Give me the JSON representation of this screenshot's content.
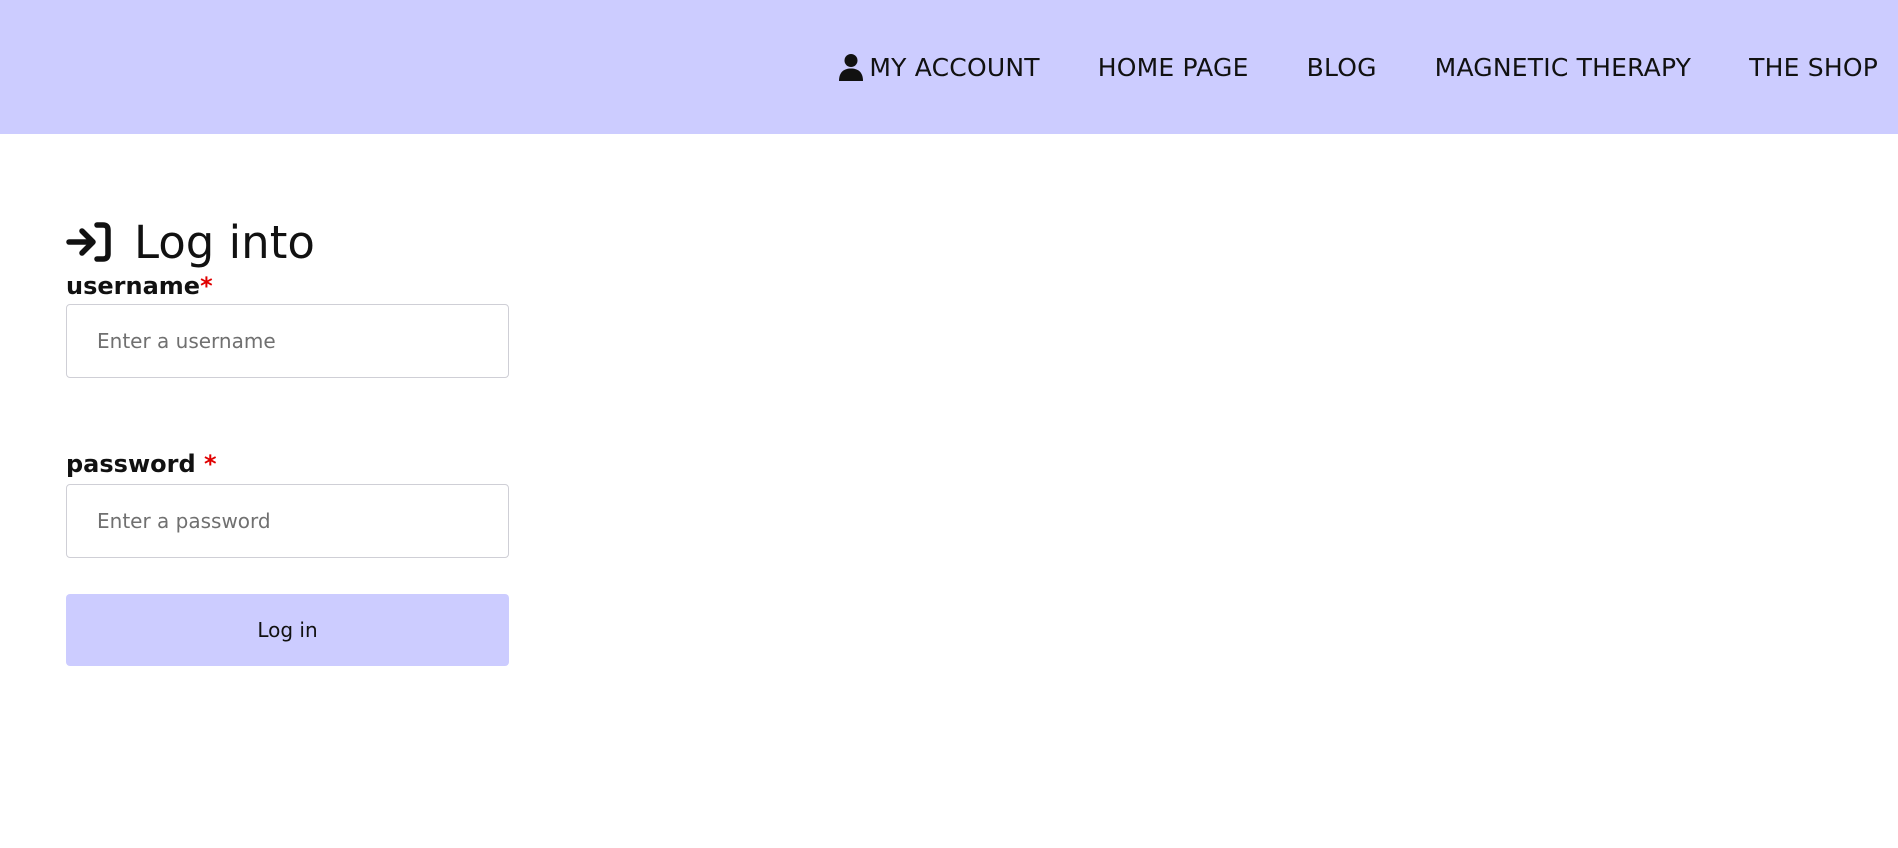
{
  "nav": {
    "items": [
      {
        "label": "MY ACCOUNT",
        "icon": "user-icon"
      },
      {
        "label": "HOME PAGE"
      },
      {
        "label": "BLOG"
      },
      {
        "label": "MAGNETIC THERAPY"
      },
      {
        "label": "THE SHOP"
      }
    ]
  },
  "login": {
    "title": "Log into",
    "title_icon": "login-arrow-icon",
    "username_label": "username",
    "username_required": "*",
    "username_placeholder": "Enter a username",
    "username_value": "",
    "password_label": "password",
    "password_required": "*",
    "password_placeholder": "Enter a password",
    "password_value": "",
    "submit_label": "Log in"
  },
  "colors": {
    "header_bg": "#ccccff",
    "button_bg": "#ccccff",
    "required": "#e00000"
  }
}
